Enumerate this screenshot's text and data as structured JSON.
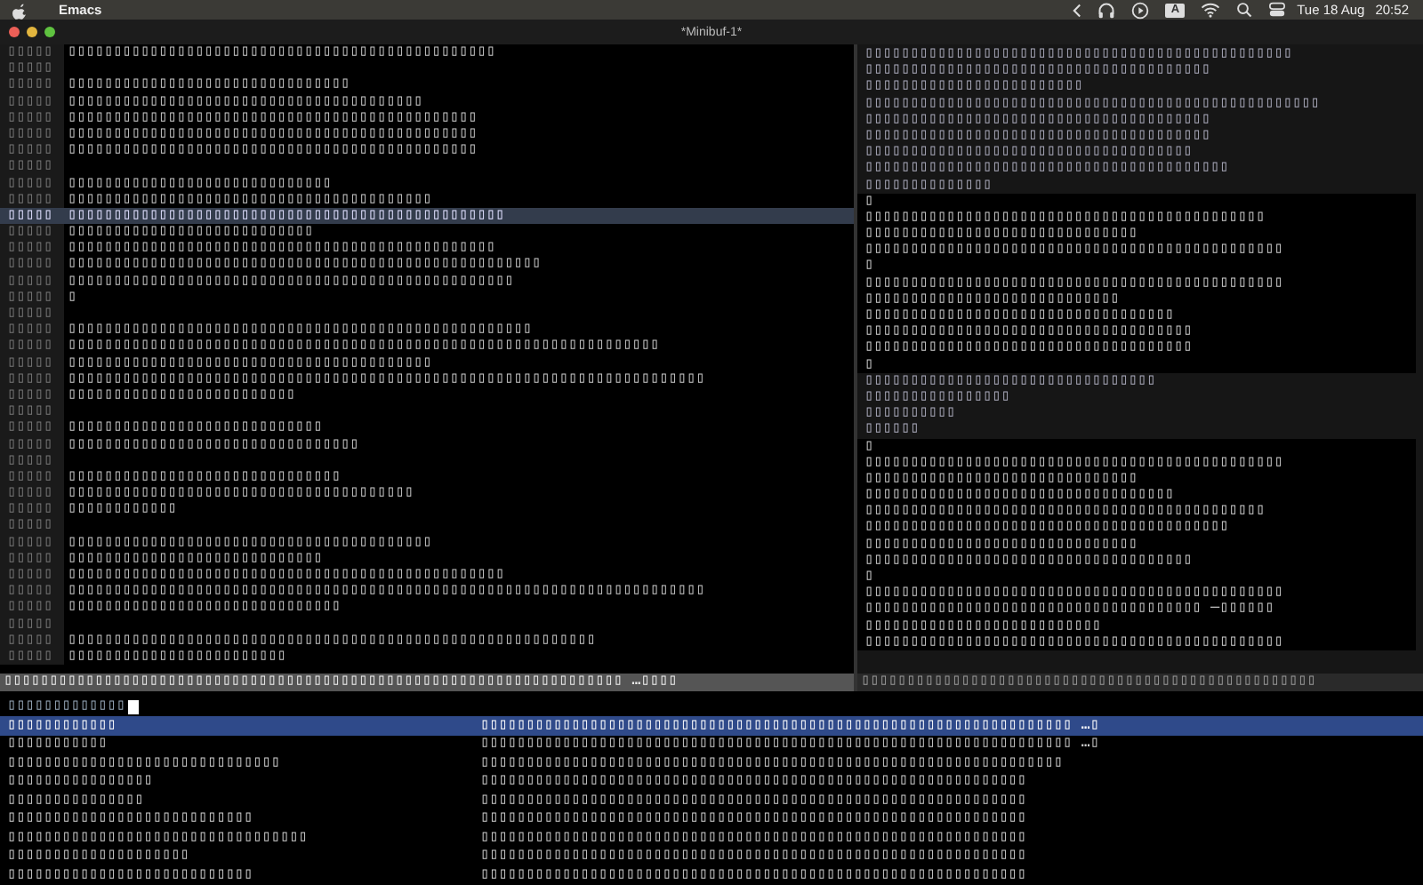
{
  "menu_bar": {
    "app_name": "Emacs",
    "input_badge": "A",
    "date": "Tue 18 Aug",
    "time": "20:52"
  },
  "window": {
    "title": "*Minibuf-1*"
  },
  "left_pane": {
    "lines": [
      {
        "num": "▯▯▯▯▯",
        "text": "▯▯▯▯▯▯▯▯▯▯▯▯▯▯▯▯▯▯▯▯▯▯▯▯▯▯▯▯▯▯▯▯▯▯▯▯▯▯▯▯▯▯▯▯▯▯▯",
        "current": false
      },
      {
        "num": "▯▯▯▯▯",
        "current": false
      },
      {
        "num": "▯▯▯▯▯",
        "text": "▯▯▯▯▯▯▯▯▯▯▯▯▯▯▯▯▯▯▯▯▯▯▯▯▯▯▯▯▯▯▯",
        "current": false
      },
      {
        "num": "▯▯▯▯▯",
        "text": "▯▯▯▯▯▯▯▯▯▯▯▯▯▯▯▯▯▯▯▯▯▯▯▯▯▯▯▯▯▯▯▯▯▯▯▯▯▯▯",
        "current": false
      },
      {
        "num": "▯▯▯▯▯",
        "text": "▯▯▯▯▯▯▯▯▯▯▯▯▯▯▯▯▯▯▯▯▯▯▯▯▯▯▯▯▯▯▯▯▯▯▯▯▯▯▯▯▯▯▯▯▯",
        "current": false
      },
      {
        "num": "▯▯▯▯▯",
        "text": "▯▯▯▯▯▯▯▯▯▯▯▯▯▯▯▯▯▯▯▯▯▯▯▯▯▯▯▯▯▯▯▯▯▯▯▯▯▯▯▯▯▯▯▯▯",
        "current": false
      },
      {
        "num": "▯▯▯▯▯",
        "text": "▯▯▯▯▯▯▯▯▯▯▯▯▯▯▯▯▯▯▯▯▯▯▯▯▯▯▯▯▯▯▯▯▯▯▯▯▯▯▯▯▯▯▯▯▯",
        "current": false
      },
      {
        "num": "▯▯▯▯▯",
        "current": false
      },
      {
        "num": "▯▯▯▯▯",
        "text": "▯▯▯▯▯▯▯▯▯▯▯▯▯▯▯▯▯▯▯▯▯▯▯▯▯▯▯▯▯",
        "current": false
      },
      {
        "num": "▯▯▯▯▯",
        "text": "▯▯▯▯▯▯▯▯▯▯▯▯▯▯▯▯▯▯▯▯▯▯▯▯▯▯▯▯▯▯▯▯▯▯▯▯▯▯▯▯",
        "current": false
      },
      {
        "num": "▯▯▯▯▯",
        "text": "▯▯▯▯▯▯▯▯▯▯▯▯▯▯▯▯▯▯▯▯▯▯▯▯▯▯▯▯▯▯▯▯▯▯▯▯▯▯▯▯▯▯▯▯▯▯▯▯",
        "current": true
      },
      {
        "num": "▯▯▯▯▯",
        "text": "▯▯▯▯▯▯▯▯▯▯▯▯▯▯▯▯▯▯▯▯▯▯▯▯▯▯▯",
        "current": false
      },
      {
        "num": "▯▯▯▯▯",
        "text": "▯▯▯▯▯▯▯▯▯▯▯▯▯▯▯▯▯▯▯▯▯▯▯▯▯▯▯▯▯▯▯▯▯▯▯▯▯▯▯▯▯▯▯▯▯▯▯",
        "current": false
      },
      {
        "num": "▯▯▯▯▯",
        "text": "▯▯▯▯▯▯▯▯▯▯▯▯▯▯▯▯▯▯▯▯▯▯▯▯▯▯▯▯▯▯▯▯▯▯▯▯▯▯▯▯▯▯▯▯▯▯▯▯▯▯▯▯",
        "current": false
      },
      {
        "num": "▯▯▯▯▯",
        "text": "▯▯▯▯▯▯▯▯▯▯▯▯▯▯▯▯▯▯▯▯▯▯▯▯▯▯▯▯▯▯▯▯▯▯▯▯▯▯▯▯▯▯▯▯▯▯▯▯▯",
        "current": false
      },
      {
        "num": "▯▯▯▯▯",
        "text": "▯",
        "current": false
      },
      {
        "num": "▯▯▯▯▯",
        "current": false
      },
      {
        "num": "▯▯▯▯▯",
        "text": "▯▯▯▯▯▯▯▯▯▯▯▯▯▯▯▯▯▯▯▯▯▯▯▯▯▯▯▯▯▯▯▯▯▯▯▯▯▯▯▯▯▯▯▯▯▯▯▯▯▯▯",
        "current": false
      },
      {
        "num": "▯▯▯▯▯",
        "text": "▯▯▯▯▯▯▯▯▯▯▯▯▯▯▯▯▯▯▯▯▯▯▯▯▯▯▯▯▯▯▯▯▯▯▯▯▯▯▯▯▯▯▯▯▯▯▯▯▯▯▯▯▯▯▯▯▯▯▯▯▯▯▯▯▯",
        "current": false
      },
      {
        "num": "▯▯▯▯▯",
        "text": "▯▯▯▯▯▯▯▯▯▯▯▯▯▯▯▯▯▯▯▯▯▯▯▯▯▯▯▯▯▯▯▯▯▯▯▯▯▯▯▯",
        "current": false
      },
      {
        "num": "▯▯▯▯▯",
        "text": "▯▯▯▯▯▯▯▯▯▯▯▯▯▯▯▯▯▯▯▯▯▯▯▯▯▯▯▯▯▯▯▯▯▯▯▯▯▯▯▯▯▯▯▯▯▯▯▯▯▯▯▯▯▯▯▯▯▯▯▯▯▯▯▯▯▯▯▯▯▯",
        "current": false
      },
      {
        "num": "▯▯▯▯▯",
        "text": "▯▯▯▯▯▯▯▯▯▯▯▯▯▯▯▯▯▯▯▯▯▯▯▯▯",
        "current": false
      },
      {
        "num": "▯▯▯▯▯",
        "current": false
      },
      {
        "num": "▯▯▯▯▯",
        "text": "▯▯▯▯▯▯▯▯▯▯▯▯▯▯▯▯▯▯▯▯▯▯▯▯▯▯▯▯",
        "current": false
      },
      {
        "num": "▯▯▯▯▯",
        "text": "▯▯▯▯▯▯▯▯▯▯▯▯▯▯▯▯▯▯▯▯▯▯▯▯▯▯▯▯▯▯▯▯",
        "current": false
      },
      {
        "num": "▯▯▯▯▯",
        "current": false
      },
      {
        "num": "▯▯▯▯▯",
        "text": "▯▯▯▯▯▯▯▯▯▯▯▯▯▯▯▯▯▯▯▯▯▯▯▯▯▯▯▯▯▯",
        "current": false
      },
      {
        "num": "▯▯▯▯▯",
        "text": "▯▯▯▯▯▯▯▯▯▯▯▯▯▯▯▯▯▯▯▯▯▯▯▯▯▯▯▯▯▯▯▯▯▯▯▯▯▯",
        "current": false
      },
      {
        "num": "▯▯▯▯▯",
        "text": "▯▯▯▯▯▯▯▯▯▯▯▯",
        "current": false
      },
      {
        "num": "▯▯▯▯▯",
        "current": false
      },
      {
        "num": "▯▯▯▯▯",
        "text": "▯▯▯▯▯▯▯▯▯▯▯▯▯▯▯▯▯▯▯▯▯▯▯▯▯▯▯▯▯▯▯▯▯▯▯▯▯▯▯▯",
        "current": false
      },
      {
        "num": "▯▯▯▯▯",
        "text": "▯▯▯▯▯▯▯▯▯▯▯▯▯▯▯▯▯▯▯▯▯▯▯▯▯▯▯▯",
        "current": false
      },
      {
        "num": "▯▯▯▯▯",
        "text": "▯▯▯▯▯▯▯▯▯▯▯▯▯▯▯▯▯▯▯▯▯▯▯▯▯▯▯▯▯▯▯▯▯▯▯▯▯▯▯▯▯▯▯▯▯▯▯▯",
        "current": false
      },
      {
        "num": "▯▯▯▯▯",
        "text": "▯▯▯▯▯▯▯▯▯▯▯▯▯▯▯▯▯▯▯▯▯▯▯▯▯▯▯▯▯▯▯▯▯▯▯▯▯▯▯▯▯▯▯▯▯▯▯▯▯▯▯▯▯▯▯▯▯▯▯▯▯▯▯▯▯▯▯▯▯▯",
        "current": false
      },
      {
        "num": "▯▯▯▯▯",
        "text": "▯▯▯▯▯▯▯▯▯▯▯▯▯▯▯▯▯▯▯▯▯▯▯▯▯▯▯▯▯▯",
        "current": false
      },
      {
        "num": "▯▯▯▯▯",
        "current": false
      },
      {
        "num": "▯▯▯▯▯",
        "text": "▯▯▯▯▯▯▯▯▯▯▯▯▯▯▯▯▯▯▯▯▯▯▯▯▯▯▯▯▯▯▯▯▯▯▯▯▯▯▯▯▯▯▯▯▯▯▯▯▯▯▯▯▯▯▯▯▯▯",
        "current": false
      },
      {
        "num": "▯▯▯▯▯",
        "text": "▯▯▯▯▯▯▯▯▯▯▯▯▯▯▯▯▯▯▯▯▯▯▯▯",
        "current": false
      }
    ],
    "mode_line": "▯▯▯▯▯▯▯▯▯▯▯▯▯▯▯▯▯▯▯▯▯▯▯▯▯▯▯▯▯▯▯▯▯▯▯▯▯▯▯▯▯▯▯▯▯▯▯▯▯▯▯▯▯▯▯▯▯▯▯▯▯▯▯▯▯▯▯▯ …▯▯▯▯"
  },
  "right_pane": {
    "lines": [
      {
        "kind": "plain",
        "text": "▯▯▯▯▯▯▯▯▯▯▯▯▯▯▯▯▯▯▯▯▯▯▯▯▯▯▯▯▯▯▯▯▯▯▯▯▯▯▯▯▯▯▯▯▯▯▯"
      },
      {
        "kind": "plain",
        "text": "▯▯▯▯▯▯▯▯▯▯▯▯▯▯▯▯▯▯▯▯▯▯▯▯▯▯▯▯▯▯▯▯▯▯▯▯▯▯"
      },
      {
        "kind": "plain",
        "text": "▯▯▯▯▯▯▯▯▯▯▯▯▯▯▯▯▯▯▯▯▯▯▯▯"
      },
      {
        "kind": "plain",
        "text": "▯▯▯▯▯▯▯▯▯▯▯▯▯▯▯▯▯▯▯▯▯▯▯▯▯▯▯▯▯▯▯▯▯▯▯▯▯▯▯▯▯▯▯▯▯▯▯▯▯▯"
      },
      {
        "kind": "plain",
        "text": "▯▯▯▯▯▯▯▯▯▯▯▯▯▯▯▯▯▯▯▯▯▯▯▯▯▯▯▯▯▯▯▯▯▯▯▯▯▯"
      },
      {
        "kind": "plain",
        "text": "▯▯▯▯▯▯▯▯▯▯▯▯▯▯▯▯▯▯▯▯▯▯▯▯▯▯▯▯▯▯▯▯▯▯▯▯▯▯"
      },
      {
        "kind": "plain",
        "text": "▯▯▯▯▯▯▯▯▯▯▯▯▯▯▯▯▯▯▯▯▯▯▯▯▯▯▯▯▯▯▯▯▯▯▯▯"
      },
      {
        "kind": "plain",
        "text": "▯▯▯▯▯▯▯▯▯▯▯▯▯▯▯▯▯▯▯▯▯▯▯▯▯▯▯▯▯▯▯▯▯▯▯▯▯▯▯▯"
      },
      {
        "kind": "plain",
        "text": "▯▯▯▯▯▯▯▯▯▯▯▯▯▯"
      },
      {
        "kind": "block",
        "text": "▯"
      },
      {
        "kind": "block",
        "text": "▯▯▯▯▯▯▯▯▯▯▯▯▯▯▯▯▯▯▯▯▯▯▯▯▯▯▯▯▯▯▯▯▯▯▯▯▯▯▯▯▯▯▯▯"
      },
      {
        "kind": "block",
        "text": "▯▯▯▯▯▯▯▯▯▯▯▯▯▯▯▯▯▯▯▯▯▯▯▯▯▯▯▯▯▯"
      },
      {
        "kind": "block",
        "text": "▯▯▯▯▯▯▯▯▯▯▯▯▯▯▯▯▯▯▯▯▯▯▯▯▯▯▯▯▯▯▯▯▯▯▯▯▯▯▯▯▯▯▯▯▯▯"
      },
      {
        "kind": "block",
        "text": "▯"
      },
      {
        "kind": "block",
        "text": "▯▯▯▯▯▯▯▯▯▯▯▯▯▯▯▯▯▯▯▯▯▯▯▯▯▯▯▯▯▯▯▯▯▯▯▯▯▯▯▯▯▯▯▯▯▯"
      },
      {
        "kind": "block",
        "text": "▯▯▯▯▯▯▯▯▯▯▯▯▯▯▯▯▯▯▯▯▯▯▯▯▯▯▯▯"
      },
      {
        "kind": "block",
        "text": "▯▯▯▯▯▯▯▯▯▯▯▯▯▯▯▯▯▯▯▯▯▯▯▯▯▯▯▯▯▯▯▯▯▯"
      },
      {
        "kind": "block",
        "text": "▯▯▯▯▯▯▯▯▯▯▯▯▯▯▯▯▯▯▯▯▯▯▯▯▯▯▯▯▯▯▯▯▯▯▯▯"
      },
      {
        "kind": "block",
        "text": "▯▯▯▯▯▯▯▯▯▯▯▯▯▯▯▯▯▯▯▯▯▯▯▯▯▯▯▯▯▯▯▯▯▯▯▯"
      },
      {
        "kind": "block",
        "text": "▯"
      },
      {
        "kind": "plain",
        "text": "▯▯▯▯▯▯▯▯▯▯▯▯▯▯▯▯▯▯▯▯▯▯▯▯▯▯▯▯▯▯▯▯"
      },
      {
        "kind": "plain",
        "text": "▯▯▯▯▯▯▯▯▯▯▯▯▯▯▯▯"
      },
      {
        "kind": "plain",
        "text": "▯▯▯▯▯▯▯▯▯▯"
      },
      {
        "kind": "plain",
        "text": "▯▯▯▯▯▯"
      },
      {
        "kind": "block",
        "text": "▯"
      },
      {
        "kind": "block",
        "text": "▯▯▯▯▯▯▯▯▯▯▯▯▯▯▯▯▯▯▯▯▯▯▯▯▯▯▯▯▯▯▯▯▯▯▯▯▯▯▯▯▯▯▯▯▯▯"
      },
      {
        "kind": "block",
        "text": "▯▯▯▯▯▯▯▯▯▯▯▯▯▯▯▯▯▯▯▯▯▯▯▯▯▯▯▯▯▯"
      },
      {
        "kind": "block",
        "text": "▯▯▯▯▯▯▯▯▯▯▯▯▯▯▯▯▯▯▯▯▯▯▯▯▯▯▯▯▯▯▯▯▯▯"
      },
      {
        "kind": "block",
        "text": "▯▯▯▯▯▯▯▯▯▯▯▯▯▯▯▯▯▯▯▯▯▯▯▯▯▯▯▯▯▯▯▯▯▯▯▯▯▯▯▯▯▯▯▯"
      },
      {
        "kind": "block",
        "text": "▯▯▯▯▯▯▯▯▯▯▯▯▯▯▯▯▯▯▯▯▯▯▯▯▯▯▯▯▯▯▯▯▯▯▯▯▯▯▯▯"
      },
      {
        "kind": "block",
        "text": "▯▯▯▯▯▯▯▯▯▯▯▯▯▯▯▯▯▯▯▯▯▯▯▯▯▯▯▯▯▯"
      },
      {
        "kind": "block",
        "text": "▯▯▯▯▯▯▯▯▯▯▯▯▯▯▯▯▯▯▯▯▯▯▯▯▯▯▯▯▯▯▯▯▯▯▯▯"
      },
      {
        "kind": "block",
        "text": "▯"
      },
      {
        "kind": "block",
        "text": "▯▯▯▯▯▯▯▯▯▯▯▯▯▯▯▯▯▯▯▯▯▯▯▯▯▯▯▯▯▯▯▯▯▯▯▯▯▯▯▯▯▯▯▯▯▯"
      },
      {
        "kind": "block",
        "text": "▯▯▯▯▯▯▯▯▯▯▯▯▯▯▯▯▯▯▯▯▯▯▯▯▯▯▯▯▯▯▯▯▯▯▯▯▯ —▯▯▯▯▯▯"
      },
      {
        "kind": "block",
        "text": "▯▯▯▯▯▯▯▯▯▯▯▯▯▯▯▯▯▯▯▯▯▯▯▯▯▯"
      },
      {
        "kind": "block",
        "text": "▯▯▯▯▯▯▯▯▯▯▯▯▯▯▯▯▯▯▯▯▯▯▯▯▯▯▯▯▯▯▯▯▯▯▯▯▯▯▯▯▯▯▯▯▯▯"
      }
    ],
    "mode_line": "▯▯▯▯▯▯▯▯▯▯▯▯▯▯▯▯▯▯▯▯▯▯▯▯▯▯▯▯▯▯▯▯▯▯▯▯▯▯▯▯▯▯▯▯▯▯▯▯▯▯"
  },
  "minibuffer": {
    "prompt": "▯▯▯▯▯▯▯▯▯▯▯▯▯",
    "completions": [
      {
        "name": "▯▯▯▯▯▯▯▯▯▯▯▯",
        "detail": "▯▯▯▯▯▯▯▯▯▯▯▯▯▯▯▯▯▯▯▯▯▯▯▯▯▯▯▯▯▯▯▯▯▯▯▯▯▯▯▯▯▯▯▯▯▯▯▯▯▯▯▯▯▯▯▯▯▯▯▯▯▯▯▯▯ …▯",
        "selected": true
      },
      {
        "name": "▯▯▯▯▯▯▯▯▯▯▯",
        "detail": "▯▯▯▯▯▯▯▯▯▯▯▯▯▯▯▯▯▯▯▯▯▯▯▯▯▯▯▯▯▯▯▯▯▯▯▯▯▯▯▯▯▯▯▯▯▯▯▯▯▯▯▯▯▯▯▯▯▯▯▯▯▯▯▯▯ …▯",
        "selected": false
      },
      {
        "name": "▯▯▯▯▯▯▯▯▯▯▯▯▯▯▯▯▯▯▯▯▯▯▯▯▯▯▯▯▯▯",
        "detail": "▯▯▯▯▯▯▯▯▯▯▯▯▯▯▯▯▯▯▯▯▯▯▯▯▯▯▯▯▯▯▯▯▯▯▯▯▯▯▯▯▯▯▯▯▯▯▯▯▯▯▯▯▯▯▯▯▯▯▯▯▯▯▯▯",
        "selected": false
      },
      {
        "name": "▯▯▯▯▯▯▯▯▯▯▯▯▯▯▯▯",
        "detail": "▯▯▯▯▯▯▯▯▯▯▯▯▯▯▯▯▯▯▯▯▯▯▯▯▯▯▯▯▯▯▯▯▯▯▯▯▯▯▯▯▯▯▯▯▯▯▯▯▯▯▯▯▯▯▯▯▯▯▯▯",
        "selected": false
      },
      {
        "name": "▯▯▯▯▯▯▯▯▯▯▯▯▯▯▯",
        "detail": "▯▯▯▯▯▯▯▯▯▯▯▯▯▯▯▯▯▯▯▯▯▯▯▯▯▯▯▯▯▯▯▯▯▯▯▯▯▯▯▯▯▯▯▯▯▯▯▯▯▯▯▯▯▯▯▯▯▯▯▯",
        "selected": false
      },
      {
        "name": "▯▯▯▯▯▯▯▯▯▯▯▯▯▯▯▯▯▯▯▯▯▯▯▯▯▯▯",
        "detail": "▯▯▯▯▯▯▯▯▯▯▯▯▯▯▯▯▯▯▯▯▯▯▯▯▯▯▯▯▯▯▯▯▯▯▯▯▯▯▯▯▯▯▯▯▯▯▯▯▯▯▯▯▯▯▯▯▯▯▯▯",
        "selected": false
      },
      {
        "name": "▯▯▯▯▯▯▯▯▯▯▯▯▯▯▯▯▯▯▯▯▯▯▯▯▯▯▯▯▯▯▯▯▯",
        "detail": "▯▯▯▯▯▯▯▯▯▯▯▯▯▯▯▯▯▯▯▯▯▯▯▯▯▯▯▯▯▯▯▯▯▯▯▯▯▯▯▯▯▯▯▯▯▯▯▯▯▯▯▯▯▯▯▯▯▯▯▯",
        "selected": false
      },
      {
        "name": "▯▯▯▯▯▯▯▯▯▯▯▯▯▯▯▯▯▯▯▯",
        "detail": "▯▯▯▯▯▯▯▯▯▯▯▯▯▯▯▯▯▯▯▯▯▯▯▯▯▯▯▯▯▯▯▯▯▯▯▯▯▯▯▯▯▯▯▯▯▯▯▯▯▯▯▯▯▯▯▯▯▯▯▯",
        "selected": false
      },
      {
        "name": "▯▯▯▯▯▯▯▯▯▯▯▯▯▯▯▯▯▯▯▯▯▯▯▯▯▯▯",
        "detail": "▯▯▯▯▯▯▯▯▯▯▯▯▯▯▯▯▯▯▯▯▯▯▯▯▯▯▯▯▯▯▯▯▯▯▯▯▯▯▯▯▯▯▯▯▯▯▯▯▯▯▯▯▯▯▯▯▯▯▯▯",
        "selected": false
      }
    ]
  }
}
